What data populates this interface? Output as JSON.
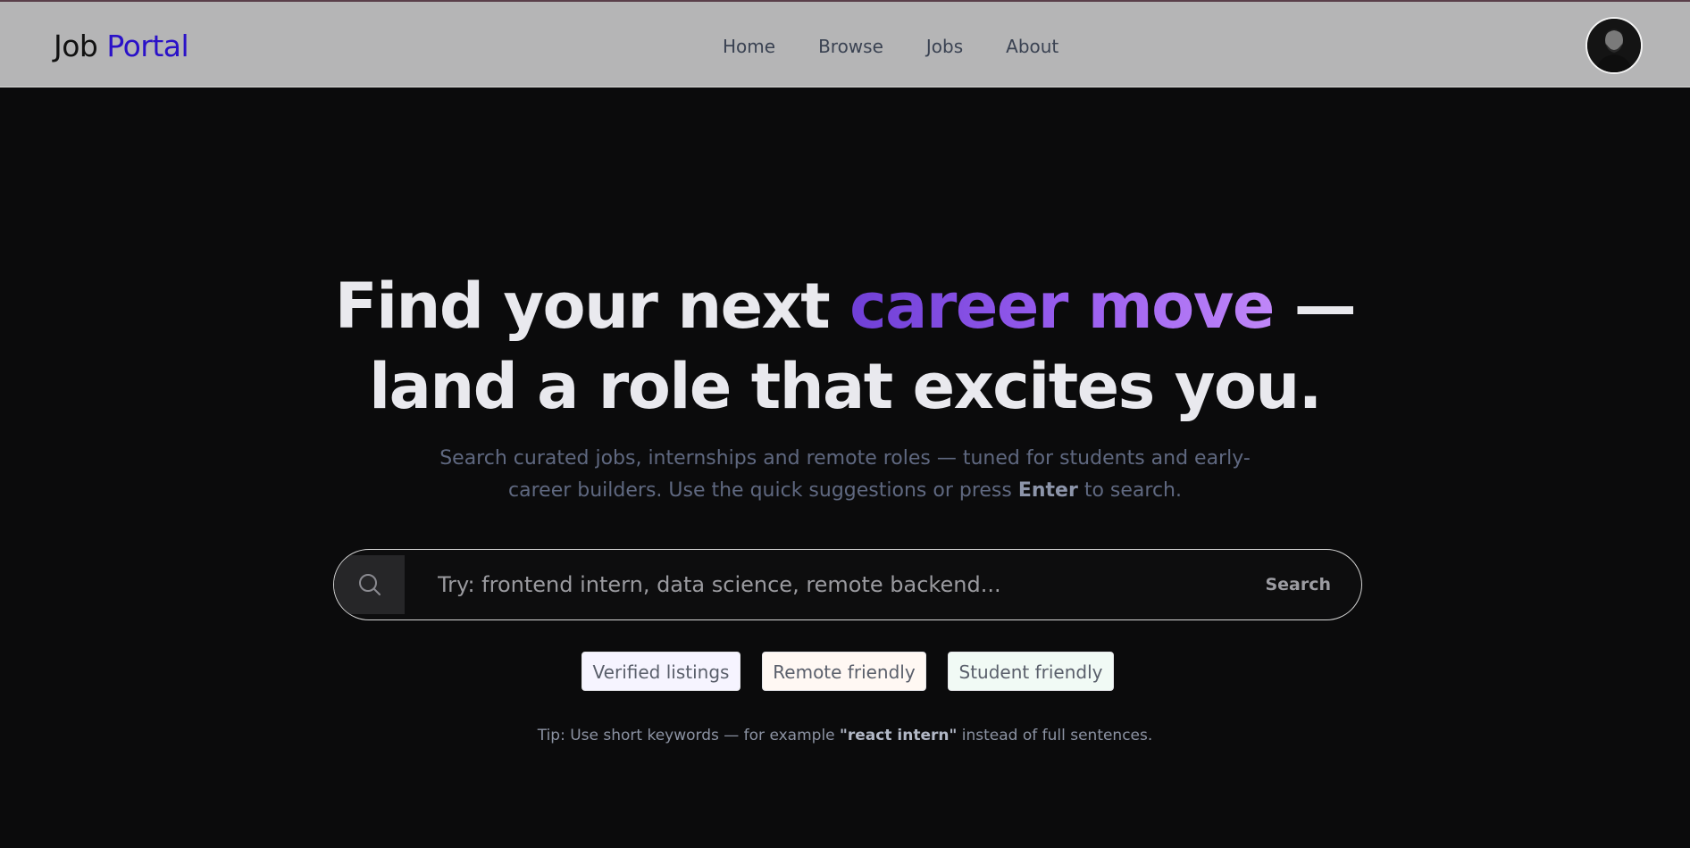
{
  "header": {
    "logo_part1": "Job",
    "logo_part2": "Portal",
    "nav": [
      {
        "label": "Home"
      },
      {
        "label": "Browse"
      },
      {
        "label": "Jobs"
      },
      {
        "label": "About"
      }
    ],
    "avatar_icon": "user-avatar"
  },
  "hero": {
    "headline_part1": "Find your next ",
    "headline_highlight": "career move",
    "headline_part2": " —",
    "headline_line2": "land a role that excites you.",
    "subtitle_part1": "Search curated jobs, internships and remote roles — tuned for students and early-career builders. Use the quick suggestions or press ",
    "subtitle_key": "Enter",
    "subtitle_part2": " to search."
  },
  "search": {
    "placeholder": "Try: frontend intern, data science, remote backend...",
    "value": "",
    "button_label": "Search",
    "icon": "search-icon"
  },
  "chips": [
    {
      "label": "Verified listings"
    },
    {
      "label": "Remote friendly"
    },
    {
      "label": "Student friendly"
    }
  ],
  "tip": {
    "part1": "Tip: Use short keywords — for example ",
    "example": "\"react intern\"",
    "part2": " instead of full sentences."
  },
  "colors": {
    "header_bg": "#b5b5b6",
    "page_bg": "#0b0b0c",
    "logo_accent": "#2a11c8",
    "headline_gradient_start": "#6f3fd6",
    "headline_gradient_end": "#c087f8"
  }
}
